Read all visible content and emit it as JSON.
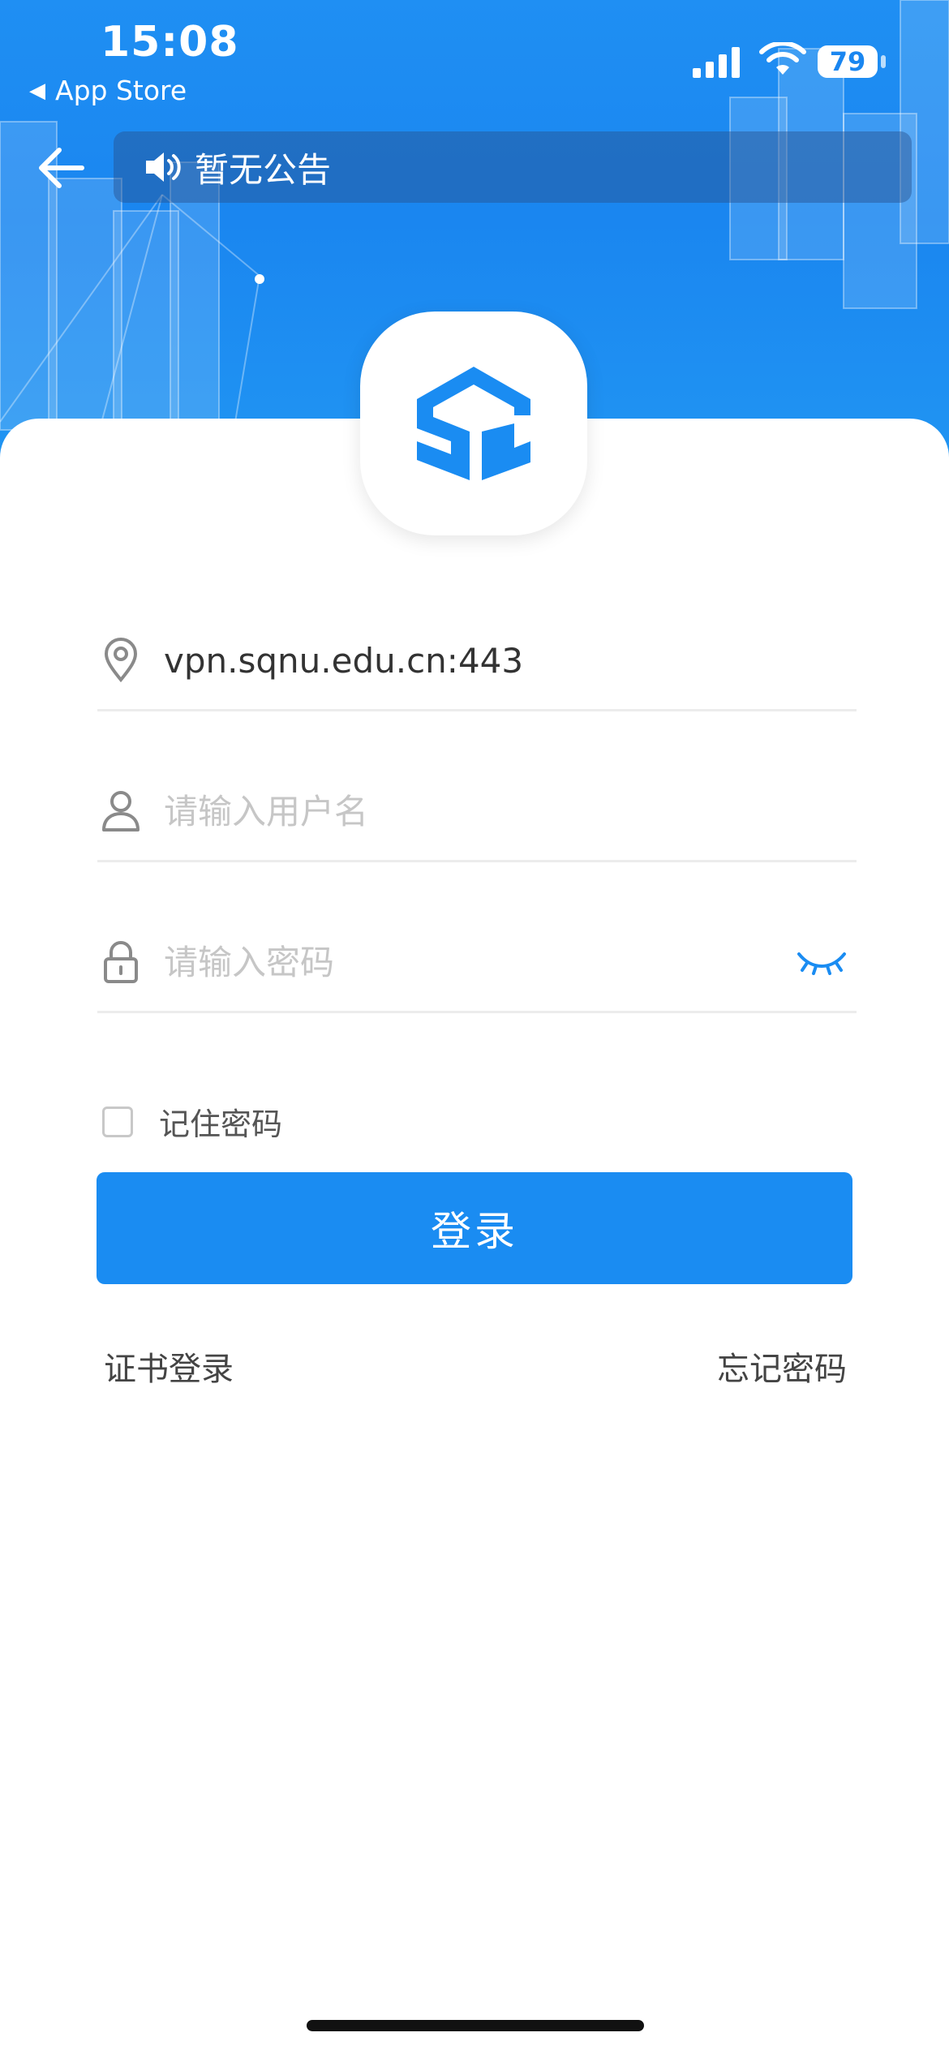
{
  "status_bar": {
    "time": "15:08",
    "back_app": "App Store",
    "battery": "79"
  },
  "header": {
    "notice": "暂无公告"
  },
  "form": {
    "server": "vpn.sqnu.edu.cn:443",
    "username_placeholder": "请输入用户名",
    "password_placeholder": "请输入密码",
    "remember_label": "记住密码",
    "login_label": "登录",
    "cert_login": "证书登录",
    "forgot_password": "忘记密码"
  },
  "colors": {
    "primary": "#1a8cf2",
    "hero": "#1f8ff3",
    "placeholder": "#c6c6c6"
  },
  "icons": [
    "back-arrow-icon",
    "speaker-icon",
    "app-logo",
    "location-pin-icon",
    "user-icon",
    "lock-icon",
    "eye-closed-icon",
    "checkbox"
  ]
}
